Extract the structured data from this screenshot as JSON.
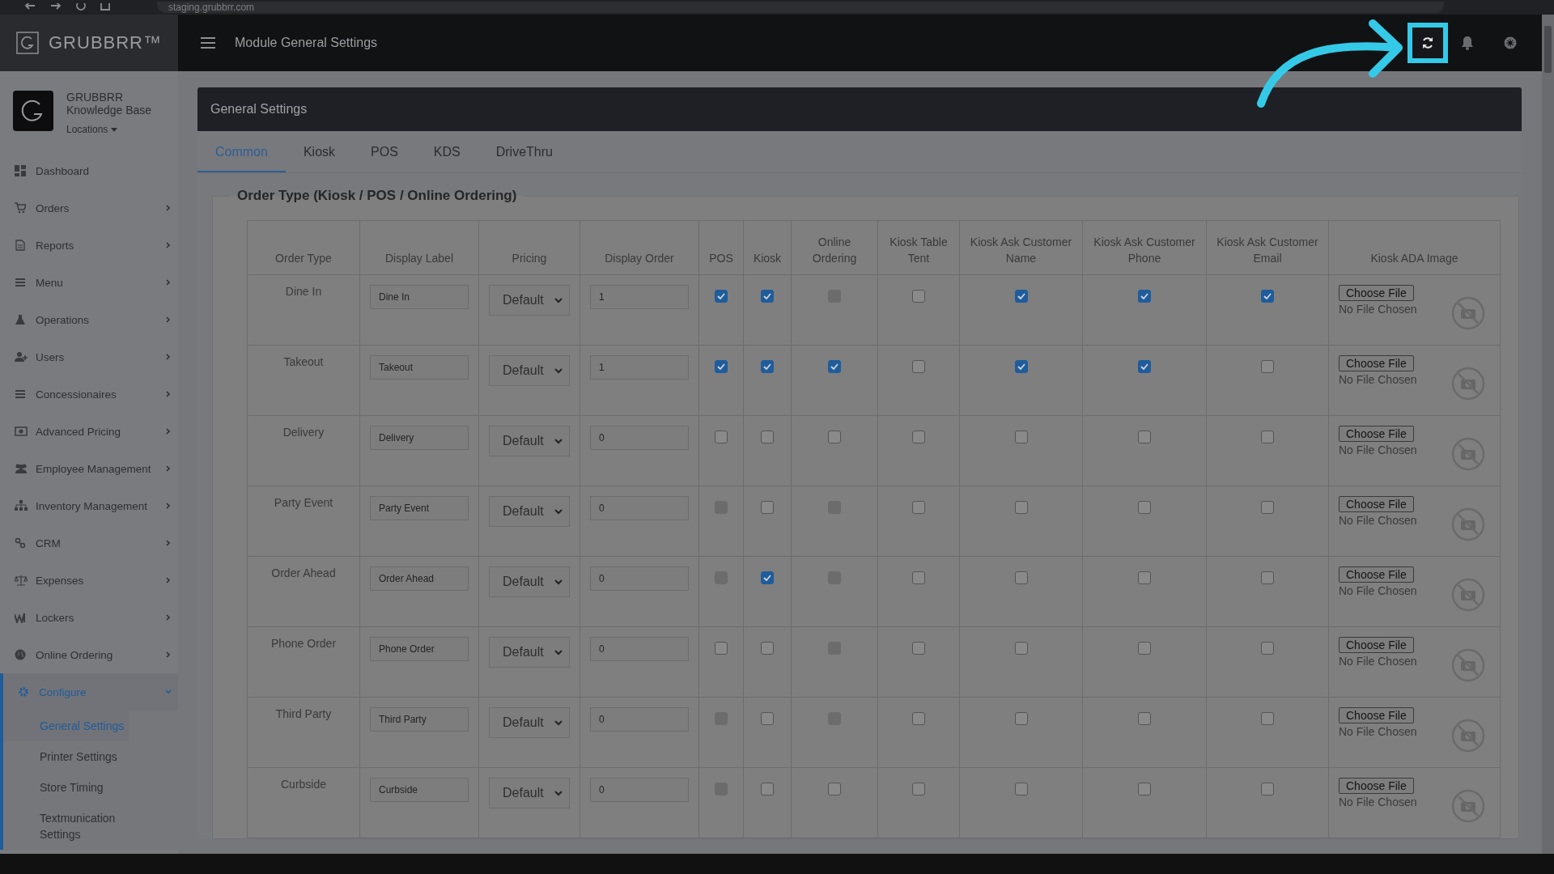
{
  "browser": {
    "url": "staging.grubbrr.com"
  },
  "header": {
    "brand": "GRUBBRR™",
    "page_title": "Module General Settings"
  },
  "sidebar": {
    "account": {
      "name": "GRUBBRR",
      "subtitle": "Knowledge Base",
      "locations": "Locations"
    },
    "items": [
      {
        "label": "Dashboard",
        "kind": "link",
        "selected": false
      },
      {
        "label": "Orders",
        "kind": "menu",
        "expanded": false,
        "selected": false
      },
      {
        "label": "Reports",
        "kind": "menu",
        "expanded": false,
        "selected": false
      },
      {
        "label": "Menu",
        "kind": "menu",
        "expanded": false,
        "selected": false
      },
      {
        "label": "Operations",
        "kind": "menu",
        "expanded": false,
        "selected": false
      },
      {
        "label": "Users",
        "kind": "menu",
        "expanded": false,
        "selected": false
      },
      {
        "label": "Concessionaires",
        "kind": "menu",
        "expanded": false,
        "selected": false
      },
      {
        "label": "Advanced Pricing",
        "kind": "menu",
        "expanded": false,
        "selected": false
      },
      {
        "label": "Employee Management",
        "kind": "menu",
        "expanded": false,
        "selected": false
      },
      {
        "label": "Inventory Management",
        "kind": "menu",
        "expanded": false,
        "selected": false
      },
      {
        "label": "CRM",
        "kind": "menu",
        "expanded": false,
        "selected": false
      },
      {
        "label": "Expenses",
        "kind": "menu",
        "expanded": false,
        "selected": false
      },
      {
        "label": "Lockers",
        "kind": "menu",
        "expanded": false,
        "selected": false
      },
      {
        "label": "Online Ordering",
        "kind": "menu",
        "expanded": false,
        "selected": false
      },
      {
        "label": "Configure",
        "kind": "menu",
        "expanded": true,
        "selected": true,
        "children": [
          {
            "label": "General Settings",
            "selected": true
          },
          {
            "label": "Printer Settings",
            "selected": false
          },
          {
            "label": "Store Timing",
            "selected": false
          },
          {
            "label": "Textmunication Settings",
            "selected": false
          }
        ]
      }
    ]
  },
  "panel": {
    "title": "General Settings",
    "tabs": [
      {
        "label": "Common",
        "selected": true
      },
      {
        "label": "Kiosk",
        "selected": false
      },
      {
        "label": "POS",
        "selected": false
      },
      {
        "label": "KDS",
        "selected": false
      },
      {
        "label": "DriveThru",
        "selected": false
      }
    ],
    "legend": "Order Type (Kiosk / POS / Online Ordering)",
    "table": {
      "columns": [
        "Order Type",
        "Display Label",
        "Pricing",
        "Display Order",
        "POS",
        "Kiosk",
        "Online Ordering",
        "Kiosk Table Tent",
        "Kiosk Ask Customer Name",
        "Kiosk Ask Customer Phone",
        "Kiosk Ask Customer Email",
        "Kiosk ADA Image"
      ],
      "rows": [
        {
          "order_type": "Dine In",
          "display_label": "Dine In",
          "pricing": "Default",
          "display_order": "1",
          "file_button": "Choose File",
          "file_status": "No File Chosen",
          "checks": [
            {
              "checked": true,
              "disabled": false
            },
            {
              "checked": true,
              "disabled": false
            },
            {
              "checked": false,
              "disabled": true
            },
            {
              "checked": false,
              "disabled": false
            },
            {
              "checked": true,
              "disabled": false
            },
            {
              "checked": true,
              "disabled": false
            },
            {
              "checked": true,
              "disabled": false
            }
          ]
        },
        {
          "order_type": "Takeout",
          "display_label": "Takeout",
          "pricing": "Default",
          "display_order": "1",
          "file_button": "Choose File",
          "file_status": "No File Chosen",
          "checks": [
            {
              "checked": true,
              "disabled": false
            },
            {
              "checked": true,
              "disabled": false
            },
            {
              "checked": true,
              "disabled": false
            },
            {
              "checked": false,
              "disabled": false
            },
            {
              "checked": true,
              "disabled": false
            },
            {
              "checked": true,
              "disabled": false
            },
            {
              "checked": false,
              "disabled": false
            }
          ]
        },
        {
          "order_type": "Delivery",
          "display_label": "Delivery",
          "pricing": "Default",
          "display_order": "0",
          "file_button": "Choose File",
          "file_status": "No File Chosen",
          "checks": [
            {
              "checked": false,
              "disabled": false
            },
            {
              "checked": false,
              "disabled": false
            },
            {
              "checked": false,
              "disabled": false
            },
            {
              "checked": false,
              "disabled": false
            },
            {
              "checked": false,
              "disabled": false
            },
            {
              "checked": false,
              "disabled": false
            },
            {
              "checked": false,
              "disabled": false
            }
          ]
        },
        {
          "order_type": "Party Event",
          "display_label": "Party Event",
          "pricing": "Default",
          "display_order": "0",
          "file_button": "Choose File",
          "file_status": "No File Chosen",
          "checks": [
            {
              "checked": false,
              "disabled": true
            },
            {
              "checked": false,
              "disabled": false
            },
            {
              "checked": false,
              "disabled": true
            },
            {
              "checked": false,
              "disabled": false
            },
            {
              "checked": false,
              "disabled": false
            },
            {
              "checked": false,
              "disabled": false
            },
            {
              "checked": false,
              "disabled": false
            }
          ]
        },
        {
          "order_type": "Order Ahead",
          "display_label": "Order Ahead",
          "pricing": "Default",
          "display_order": "0",
          "file_button": "Choose File",
          "file_status": "No File Chosen",
          "checks": [
            {
              "checked": false,
              "disabled": true
            },
            {
              "checked": true,
              "disabled": false
            },
            {
              "checked": false,
              "disabled": true
            },
            {
              "checked": false,
              "disabled": false
            },
            {
              "checked": false,
              "disabled": false
            },
            {
              "checked": false,
              "disabled": false
            },
            {
              "checked": false,
              "disabled": false
            }
          ]
        },
        {
          "order_type": "Phone Order",
          "display_label": "Phone Order",
          "pricing": "Default",
          "display_order": "0",
          "file_button": "Choose File",
          "file_status": "No File Chosen",
          "checks": [
            {
              "checked": false,
              "disabled": false
            },
            {
              "checked": false,
              "disabled": false
            },
            {
              "checked": false,
              "disabled": true
            },
            {
              "checked": false,
              "disabled": false
            },
            {
              "checked": false,
              "disabled": false
            },
            {
              "checked": false,
              "disabled": false
            },
            {
              "checked": false,
              "disabled": false
            }
          ]
        },
        {
          "order_type": "Third Party",
          "display_label": "Third Party",
          "pricing": "Default",
          "display_order": "0",
          "file_button": "Choose File",
          "file_status": "No File Chosen",
          "checks": [
            {
              "checked": false,
              "disabled": true
            },
            {
              "checked": false,
              "disabled": false
            },
            {
              "checked": false,
              "disabled": true
            },
            {
              "checked": false,
              "disabled": false
            },
            {
              "checked": false,
              "disabled": false
            },
            {
              "checked": false,
              "disabled": false
            },
            {
              "checked": false,
              "disabled": false
            }
          ]
        },
        {
          "order_type": "Curbside",
          "display_label": "Curbside",
          "pricing": "Default",
          "display_order": "0",
          "file_button": "Choose File",
          "file_status": "No File Chosen",
          "checks": [
            {
              "checked": false,
              "disabled": true
            },
            {
              "checked": false,
              "disabled": false
            },
            {
              "checked": false,
              "disabled": false
            },
            {
              "checked": false,
              "disabled": false
            },
            {
              "checked": false,
              "disabled": false
            },
            {
              "checked": false,
              "disabled": false
            },
            {
              "checked": false,
              "disabled": false
            }
          ]
        }
      ]
    }
  }
}
